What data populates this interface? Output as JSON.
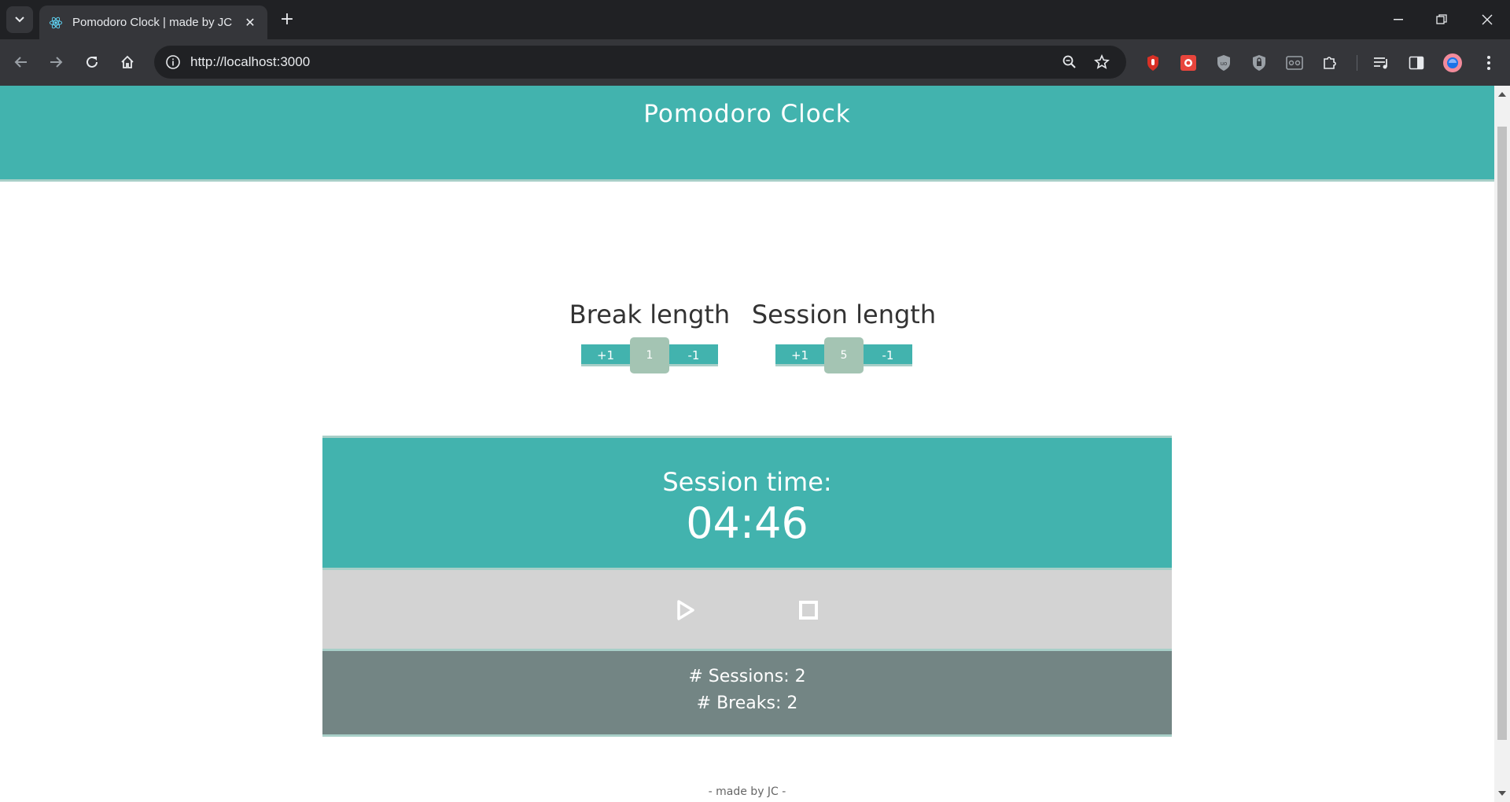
{
  "browser": {
    "tab_title": "Pomodoro Clock | made by JC",
    "url": "http://localhost:3000",
    "icons": [
      "tab-search-icon",
      "react-favicon",
      "close-icon",
      "plus-icon",
      "minimize-icon",
      "restore-icon",
      "window-close-icon",
      "back-icon",
      "forward-icon",
      "reload-icon",
      "home-icon",
      "site-info-icon",
      "zoom-icon",
      "star-icon",
      "extension-icons",
      "profile-avatar",
      "more-icon"
    ]
  },
  "header": {
    "title": "Pomodoro Clock"
  },
  "settings": {
    "break": {
      "label": "Break length",
      "plus": "+1",
      "value": "1",
      "minus": "-1"
    },
    "session": {
      "label": "Session length",
      "plus": "+1",
      "value": "5",
      "minus": "-1"
    }
  },
  "clock": {
    "label": "Session time:",
    "time": "04:46"
  },
  "controls": {
    "play_icon": "play-icon",
    "stop_icon": "stop-icon"
  },
  "stats": {
    "sessions": "# Sessions: 2",
    "breaks": "# Breaks: 2"
  },
  "footer": {
    "text": "- made by JC -"
  },
  "colors": {
    "accent": "#42b3ae",
    "value_box": "#a4c4b3",
    "controls_bg": "#d3d3d3",
    "stats_bg": "#738584"
  }
}
